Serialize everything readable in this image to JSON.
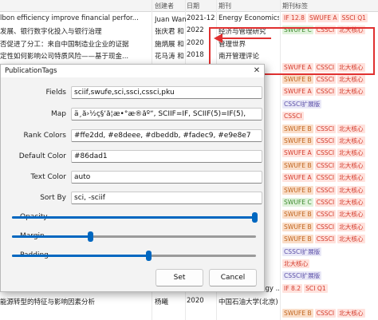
{
  "table": {
    "headers": {
      "creator": "创建者",
      "date": "日期",
      "publication": "期刊",
      "tags": "期刊标签"
    },
    "rows": [
      {
        "title": "lbon efficiency improve financial perfor...",
        "creator": "Juan Wang 等",
        "date": "2021-12",
        "publication": "Energy Economics",
        "tags": [
          {
            "text": "IF 12.8",
            "bg": "#ffe2dd",
            "fg": "#d33b2c"
          },
          {
            "text": "SWUFE A",
            "bg": "#ffe2dd",
            "fg": "#d33b2c"
          },
          {
            "text": "SSCI Q1",
            "bg": "#ffe2dd",
            "fg": "#d33b2c"
          }
        ]
      },
      {
        "title": "发展、银行数字化投入与银行治理",
        "creator": "张庆君 和 陈思",
        "date": "2022",
        "publication": "经济与管理研究",
        "tags": [
          {
            "text": "SWUFE C",
            "bg": "#e0f2db",
            "fg": "#3d8b2f"
          },
          {
            "text": "CSSCI",
            "bg": "#ffe2dd",
            "fg": "#d33b2c"
          },
          {
            "text": "北大核心",
            "bg": "#ffe2dd",
            "fg": "#d33b2c"
          }
        ]
      },
      {
        "title": "否促进了分工：来自中国制造业企业的证据",
        "creator": "施炳展 和 李建桐",
        "date": "2020",
        "publication": "管理世界",
        "tags": []
      },
      {
        "title": "定性如何影响公司特质风险——基于现金...",
        "creator": "花马涛 和 徐飞",
        "date": "2018",
        "publication": "南开管理评论",
        "tags": []
      },
      {
        "title": "",
        "creator": "",
        "date": "",
        "publication": "",
        "tags": [
          {
            "text": "SWUFE A",
            "bg": "#ffe2dd",
            "fg": "#d33b2c"
          },
          {
            "text": "CSSCI",
            "bg": "#ffe2dd",
            "fg": "#d33b2c"
          },
          {
            "text": "北大核心",
            "bg": "#ffe2dd",
            "fg": "#d33b2c"
          }
        ]
      },
      {
        "title": "",
        "creator": "",
        "date": "",
        "publication": "",
        "tags": [
          {
            "text": "SWUFE B",
            "bg": "#fadec9",
            "fg": "#c0641d"
          },
          {
            "text": "CSSCI",
            "bg": "#ffe2dd",
            "fg": "#d33b2c"
          },
          {
            "text": "北大核心",
            "bg": "#ffe2dd",
            "fg": "#d33b2c"
          }
        ]
      },
      {
        "title": "",
        "creator": "",
        "date": "",
        "publication": "",
        "tags": [
          {
            "text": "SWUFE A",
            "bg": "#ffe2dd",
            "fg": "#d33b2c"
          },
          {
            "text": "CSSCI",
            "bg": "#ffe2dd",
            "fg": "#d33b2c"
          },
          {
            "text": "北大核心",
            "bg": "#ffe2dd",
            "fg": "#d33b2c"
          }
        ]
      },
      {
        "title": "",
        "creator": "",
        "date": "",
        "publication": "",
        "tags": [
          {
            "text": "CSSCI扩展版",
            "bg": "#e9e8f7",
            "fg": "#5b4fa8"
          }
        ]
      },
      {
        "title": "",
        "creator": "",
        "date": "",
        "publication": "",
        "tags": [
          {
            "text": "CSSCI",
            "bg": "#ffe2dd",
            "fg": "#d33b2c"
          }
        ]
      },
      {
        "title": "",
        "creator": "",
        "date": "",
        "publication": "",
        "tags": [
          {
            "text": "SWUFE B",
            "bg": "#fadec9",
            "fg": "#c0641d"
          },
          {
            "text": "CSSCI",
            "bg": "#ffe2dd",
            "fg": "#d33b2c"
          },
          {
            "text": "北大核心",
            "bg": "#ffe2dd",
            "fg": "#d33b2c"
          }
        ]
      },
      {
        "title": "",
        "creator": "",
        "date": "",
        "publication": "",
        "tags": [
          {
            "text": "SWUFE B",
            "bg": "#fadec9",
            "fg": "#c0641d"
          },
          {
            "text": "CSSCI",
            "bg": "#ffe2dd",
            "fg": "#d33b2c"
          },
          {
            "text": "北大核心",
            "bg": "#ffe2dd",
            "fg": "#d33b2c"
          }
        ]
      },
      {
        "title": "",
        "creator": "",
        "date": "",
        "publication": "",
        "tags": [
          {
            "text": "SWUFE A",
            "bg": "#ffe2dd",
            "fg": "#d33b2c"
          },
          {
            "text": "CSSCI",
            "bg": "#ffe2dd",
            "fg": "#d33b2c"
          },
          {
            "text": "北大核心",
            "bg": "#ffe2dd",
            "fg": "#d33b2c"
          }
        ]
      },
      {
        "title": "",
        "creator": "",
        "date": "",
        "publication": "",
        "tags": [
          {
            "text": "SWUFE B",
            "bg": "#fadec9",
            "fg": "#c0641d"
          },
          {
            "text": "CSSCI",
            "bg": "#ffe2dd",
            "fg": "#d33b2c"
          },
          {
            "text": "北大核心",
            "bg": "#ffe2dd",
            "fg": "#d33b2c"
          }
        ]
      },
      {
        "title": "",
        "creator": "",
        "date": "",
        "publication": "",
        "tags": [
          {
            "text": "SWUFE A",
            "bg": "#ffe2dd",
            "fg": "#d33b2c"
          },
          {
            "text": "CSSCI",
            "bg": "#ffe2dd",
            "fg": "#d33b2c"
          },
          {
            "text": "北大核心",
            "bg": "#ffe2dd",
            "fg": "#d33b2c"
          }
        ]
      },
      {
        "title": "",
        "creator": "",
        "date": "",
        "publication": "",
        "tags": [
          {
            "text": "SWUFE B",
            "bg": "#fadec9",
            "fg": "#c0641d"
          },
          {
            "text": "CSSCI",
            "bg": "#ffe2dd",
            "fg": "#d33b2c"
          },
          {
            "text": "北大核心",
            "bg": "#ffe2dd",
            "fg": "#d33b2c"
          }
        ]
      },
      {
        "title": "",
        "creator": "",
        "date": "",
        "publication": "",
        "tags": [
          {
            "text": "SWUFE C",
            "bg": "#e0f2db",
            "fg": "#3d8b2f"
          },
          {
            "text": "CSSCI",
            "bg": "#ffe2dd",
            "fg": "#d33b2c"
          },
          {
            "text": "北大核心",
            "bg": "#ffe2dd",
            "fg": "#d33b2c"
          }
        ]
      },
      {
        "title": "",
        "creator": "",
        "date": "",
        "publication": "",
        "tags": [
          {
            "text": "SWUFE B",
            "bg": "#fadec9",
            "fg": "#c0641d"
          },
          {
            "text": "CSSCI",
            "bg": "#ffe2dd",
            "fg": "#d33b2c"
          },
          {
            "text": "北大核心",
            "bg": "#ffe2dd",
            "fg": "#d33b2c"
          }
        ]
      },
      {
        "title": "",
        "creator": "",
        "date": "",
        "publication": "",
        "tags": [
          {
            "text": "SWUFE B",
            "bg": "#fadec9",
            "fg": "#c0641d"
          },
          {
            "text": "CSSCI",
            "bg": "#ffe2dd",
            "fg": "#d33b2c"
          },
          {
            "text": "北大核心",
            "bg": "#ffe2dd",
            "fg": "#d33b2c"
          }
        ]
      },
      {
        "title": "",
        "creator": "",
        "date": "",
        "publication": "",
        "tags": [
          {
            "text": "SWUFE B",
            "bg": "#fadec9",
            "fg": "#c0641d"
          },
          {
            "text": "CSSCI",
            "bg": "#ffe2dd",
            "fg": "#d33b2c"
          },
          {
            "text": "北大核心",
            "bg": "#ffe2dd",
            "fg": "#d33b2c"
          }
        ]
      },
      {
        "title": "",
        "creator": "",
        "date": "",
        "publication": "",
        "tags": [
          {
            "text": "CSSCI扩展版",
            "bg": "#e9e8f7",
            "fg": "#5b4fa8"
          }
        ]
      },
      {
        "title": "",
        "creator": "",
        "date": "",
        "publication": "",
        "tags": [
          {
            "text": "北大核心",
            "bg": "#ffe2dd",
            "fg": "#d33b2c"
          }
        ]
      },
      {
        "title": "",
        "creator": "",
        "date": "",
        "publication": "",
        "tags": [
          {
            "text": "CSSCI扩展版",
            "bg": "#e9e8f7",
            "fg": "#5b4fa8"
          }
        ]
      },
      {
        "title": "g the energy transition: A nexus of ene...",
        "creator": "Pedro Crespo ...",
        "date": "2024",
        "publication": "Energy Strategy ...",
        "tags": [
          {
            "text": "IF 8.2",
            "bg": "#ffe2dd",
            "fg": "#d33b2c"
          },
          {
            "text": "SCI Q1",
            "bg": "#ffe2dd",
            "fg": "#d33b2c"
          }
        ]
      },
      {
        "title": "能源转型的特征与影响因素分析",
        "creator": "杨曦",
        "date": "2020",
        "publication": "中国石油大学(北京)",
        "tags": []
      },
      {
        "title": "",
        "creator": "",
        "date": "",
        "publication": "",
        "tags": [
          {
            "text": "SWUFE B",
            "bg": "#fadec9",
            "fg": "#c0641d"
          },
          {
            "text": "CSSCI",
            "bg": "#ffe2dd",
            "fg": "#d33b2c"
          },
          {
            "text": "北大核心",
            "bg": "#ffe2dd",
            "fg": "#d33b2c"
          }
        ]
      }
    ]
  },
  "dialog": {
    "title": "PublicationTags",
    "close_glyph": "✕",
    "fields": [
      {
        "key": "fields",
        "label": "Fields",
        "value": "sciif,swufe,sci,ssci,cssci,pku"
      },
      {
        "key": "map",
        "label": "Map",
        "value": "ä¸­å›½ç§‘å­¦æ•°æ®åº“, SCIIF=IF, SCIIF(5)=IF(5),"
      },
      {
        "key": "rank_colors",
        "label": "Rank Colors",
        "value": "#ffe2dd, #e8deee, #dbeddb, #fadec9, #e9e8e7"
      },
      {
        "key": "default_color",
        "label": "Default Color",
        "value": "#86dad1"
      },
      {
        "key": "text_color",
        "label": "Text Color",
        "value": "auto"
      },
      {
        "key": "sort_by",
        "label": "Sort By",
        "value": "sci, -sciif"
      }
    ],
    "sliders": [
      {
        "key": "opacity",
        "label": "Opacity",
        "fraction": 0.995
      },
      {
        "key": "margin",
        "label": "Margin",
        "fraction": 0.32
      },
      {
        "key": "padding",
        "label": "Padding",
        "fraction": 0.56
      }
    ],
    "buttons": {
      "set": "Set",
      "cancel": "Cancel"
    }
  },
  "colors": {
    "accent": "#0067c0",
    "annotation_red": "#e03030"
  }
}
